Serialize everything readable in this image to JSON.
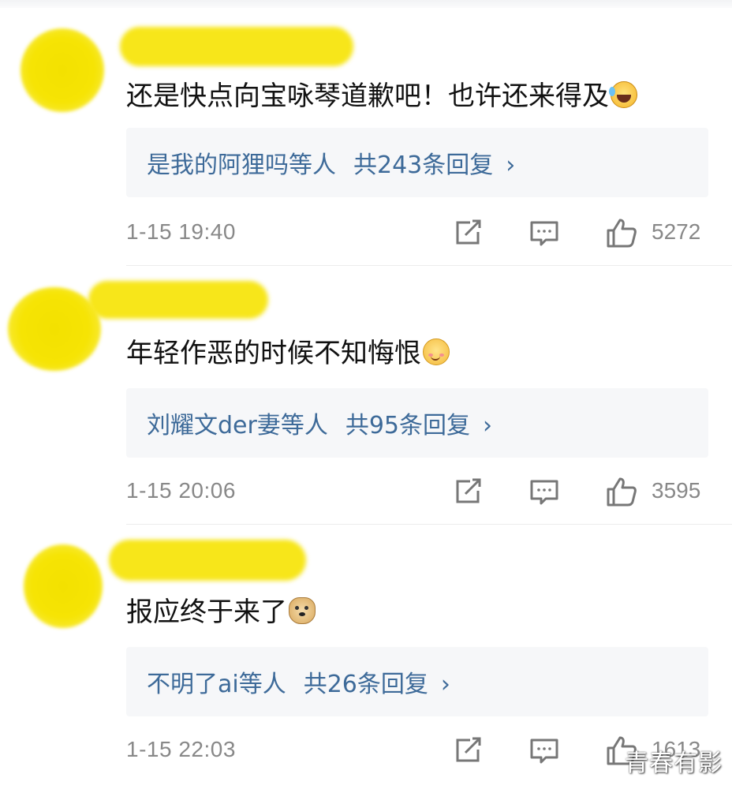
{
  "comments": [
    {
      "text": "还是快点向宝咏琴道歉吧！也许还来得及",
      "emoji": "laughing-crying-emoji",
      "reply_names": "是我的阿狸吗等人",
      "reply_count": "共243条回复",
      "time": "1-15 19:40",
      "likes": "5272"
    },
    {
      "text": "年轻作恶的时候不知悔恨",
      "emoji": "smiling-blush-emoji",
      "reply_names": "刘耀文der妻等人",
      "reply_count": "共95条回复",
      "time": "1-15 20:06",
      "likes": "3595"
    },
    {
      "text": "报应终于来了",
      "emoji": "doge-emoji",
      "reply_names": "不明了ai等人",
      "reply_count": "共26条回复",
      "time": "1-15 22:03",
      "likes": "1613"
    }
  ],
  "chevron": "›",
  "watermark": "青春有影",
  "colors": {
    "link": "#3d6a99",
    "meta": "#888888",
    "reply_bg": "#f6f7f9",
    "blur_yellow": "#f6e404"
  },
  "icons": [
    "share-icon",
    "comment-icon",
    "like-icon"
  ]
}
